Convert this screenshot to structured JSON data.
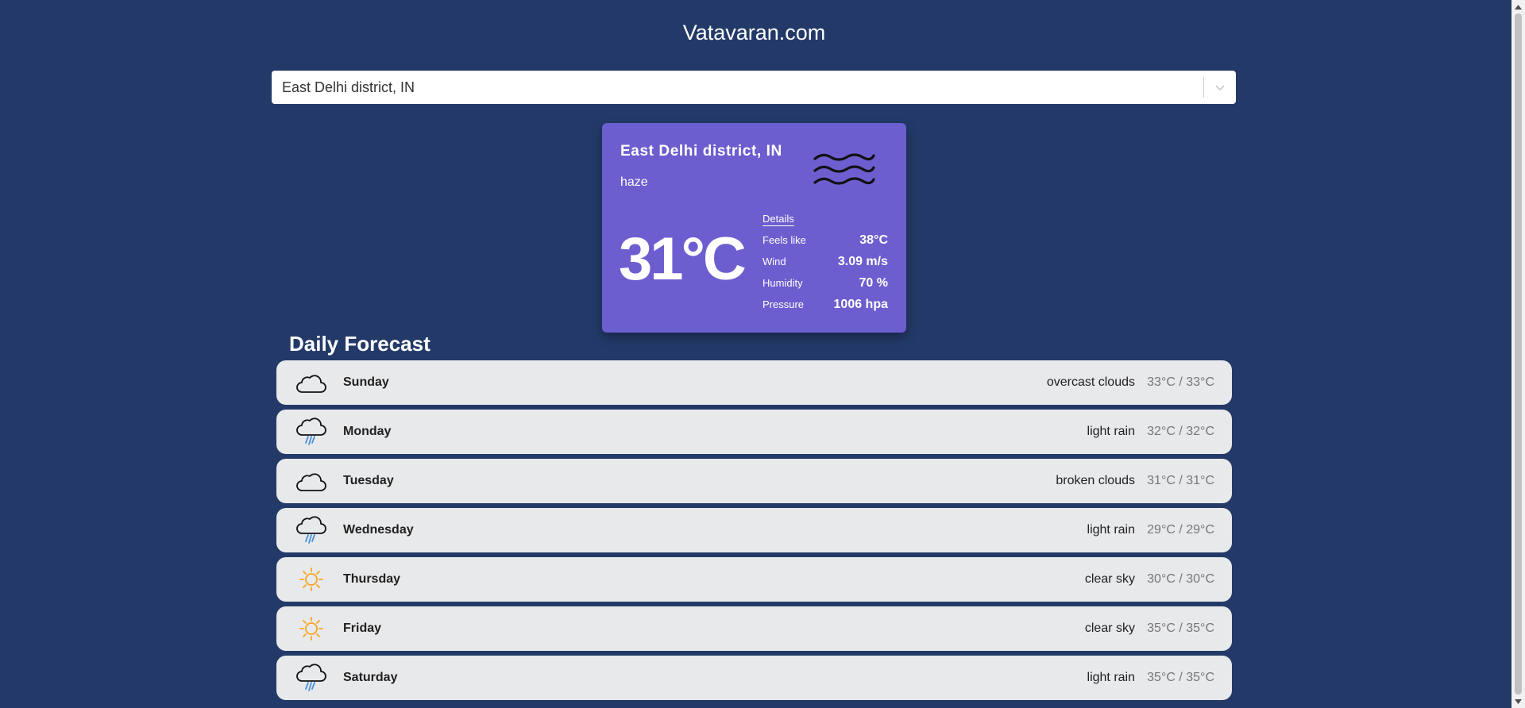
{
  "site": {
    "title": "Vatavaran.com"
  },
  "search": {
    "selected_value": "East Delhi district, IN"
  },
  "current": {
    "city": "East Delhi district, IN",
    "description": "haze",
    "icon": "haze-icon",
    "temperature": "31°C",
    "details_label": "Details",
    "details": [
      {
        "label": "Feels like",
        "value": "38°C"
      },
      {
        "label": "Wind",
        "value": "3.09 m/s"
      },
      {
        "label": "Humidity",
        "value": "70 %"
      },
      {
        "label": "Pressure",
        "value": "1006 hpa"
      }
    ]
  },
  "forecast": {
    "title": "Daily Forecast",
    "days": [
      {
        "day": "Sunday",
        "description": "overcast clouds",
        "range": "33°C / 33°C",
        "icon": "cloud-icon"
      },
      {
        "day": "Monday",
        "description": "light rain",
        "range": "32°C / 32°C",
        "icon": "rain-icon"
      },
      {
        "day": "Tuesday",
        "description": "broken clouds",
        "range": "31°C / 31°C",
        "icon": "cloud-icon"
      },
      {
        "day": "Wednesday",
        "description": "light rain",
        "range": "29°C / 29°C",
        "icon": "rain-icon"
      },
      {
        "day": "Thursday",
        "description": "clear sky",
        "range": "30°C / 30°C",
        "icon": "sun-icon"
      },
      {
        "day": "Friday",
        "description": "clear sky",
        "range": "35°C / 35°C",
        "icon": "sun-icon"
      },
      {
        "day": "Saturday",
        "description": "light rain",
        "range": "35°C / 35°C",
        "icon": "rain-icon"
      }
    ]
  },
  "colors": {
    "background": "#233a69",
    "card": "#6c5ecf",
    "row": "#e8e9eb",
    "sun": "#f5a623",
    "rain": "#4a90d9"
  }
}
